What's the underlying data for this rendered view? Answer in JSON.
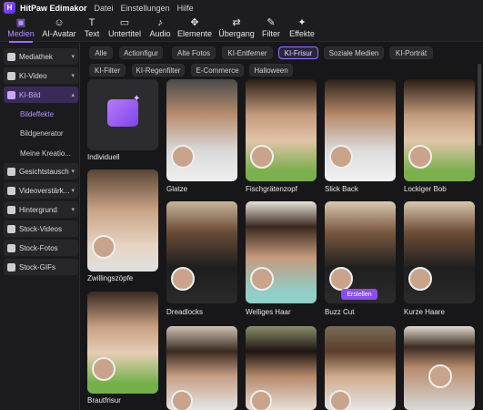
{
  "app": {
    "title": "HitPaw Edimakor",
    "menu": [
      "Datei",
      "Einstellungen",
      "Hilfe"
    ]
  },
  "toolbar": [
    {
      "label": "Medien",
      "icon": "folder-icon",
      "active": true
    },
    {
      "label": "AI-Avatar",
      "icon": "avatar-icon"
    },
    {
      "label": "Text",
      "icon": "text-icon"
    },
    {
      "label": "Untertitel",
      "icon": "subtitle-icon"
    },
    {
      "label": "Audio",
      "icon": "music-icon"
    },
    {
      "label": "Elemente",
      "icon": "elements-icon"
    },
    {
      "label": "Übergang",
      "icon": "transition-icon"
    },
    {
      "label": "Filter",
      "icon": "filter-icon"
    },
    {
      "label": "Effekte",
      "icon": "effects-icon"
    }
  ],
  "sidebar": {
    "groups": [
      {
        "label": "Mediathek"
      },
      {
        "label": "KI-Video"
      },
      {
        "label": "KI-Bild"
      }
    ],
    "sub": [
      "Bildeffekte",
      "Bildgenerator",
      "Meine Kreatio..."
    ],
    "groups2": [
      {
        "label": "Gesichtstausch"
      },
      {
        "label": "Videoverstärk..."
      },
      {
        "label": "Hintergrund"
      },
      {
        "label": "Stock-Videos"
      },
      {
        "label": "Stock-Fotos"
      },
      {
        "label": "Stock-GIFs"
      }
    ]
  },
  "filters": {
    "row1": [
      "Alle",
      "Actionfigur",
      "Alte Fotos",
      "KI-Entferner",
      "KI-Frisur",
      "Soziale Medien",
      "KI-Porträt"
    ],
    "row2": [
      "KI-Filter",
      "KI-Regenfilter",
      "E-Commerce",
      "Halloween"
    ],
    "active": "KI-Frisur"
  },
  "left_column": [
    {
      "label": "Individuell"
    },
    {
      "label": "Zwillingszöpfe"
    },
    {
      "label": "Brautfrisur"
    }
  ],
  "grid": [
    {
      "label": "Glatze"
    },
    {
      "label": "Fischgrätenzopf"
    },
    {
      "label": "Slick Back"
    },
    {
      "label": "Lockiger Bob"
    },
    {
      "label": "Dreadlocks"
    },
    {
      "label": "Welliges Haar"
    },
    {
      "label": "Buzz Cut"
    },
    {
      "label": "Kurze Haare"
    },
    {
      "label": ""
    },
    {
      "label": ""
    },
    {
      "label": ""
    },
    {
      "label": ""
    }
  ],
  "action": {
    "create": "Erstellen"
  },
  "colors": {
    "accent": "#9b6cff",
    "bg": "#17171a"
  }
}
